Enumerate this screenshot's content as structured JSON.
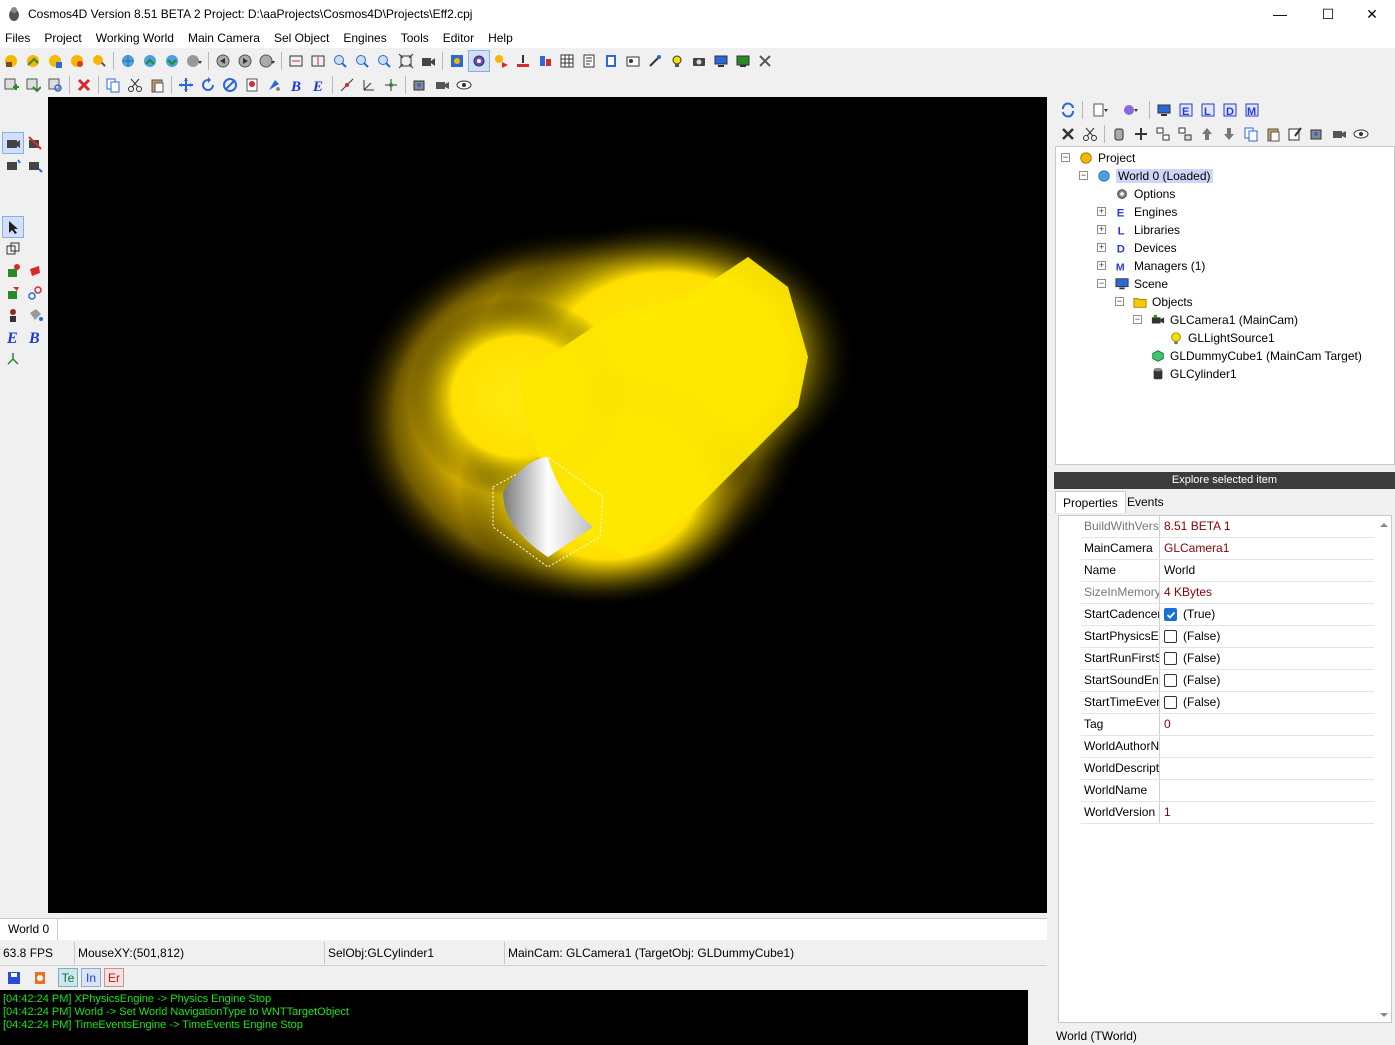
{
  "window": {
    "title": "Cosmos4D Version 8.51 BETA 2   Project: D:\\aaProjects\\Cosmos4D\\Projects\\Eff2.cpj",
    "minimize": "—",
    "maximize": "☐",
    "close": "✕"
  },
  "menu": [
    "Files",
    "Project",
    "Working World",
    "Main Camera",
    "Sel Object",
    "Engines",
    "Tools",
    "Editor",
    "Help"
  ],
  "tree": {
    "project": "Project",
    "world": "World 0  (Loaded)",
    "options": "Options",
    "engines": "Engines",
    "libraries": "Libraries",
    "devices": "Devices",
    "managers": "Managers (1)",
    "scene": "Scene",
    "objects": "Objects",
    "camera": "GLCamera1  (MainCam)",
    "light": "GLLightSource1",
    "dummy": "GLDummyCube1  (MainCam Target)",
    "cylinder": "GLCylinder1"
  },
  "explore_label": "Explore selected item",
  "tabs": {
    "properties": "Properties",
    "events": "Events"
  },
  "props": [
    {
      "name": "BuildWithVers",
      "value": "8.51 BETA 1",
      "grey": true
    },
    {
      "name": "MainCamera",
      "value": "GLCamera1"
    },
    {
      "name": "Name",
      "value": "World",
      "black": true
    },
    {
      "name": "SizeInMemory",
      "value": "4 KBytes",
      "grey": true
    },
    {
      "name": "StartCadencer",
      "value": "(True)",
      "check": true,
      "checked": true
    },
    {
      "name": "StartPhysicsEngine",
      "value": "(False)",
      "check": true
    },
    {
      "name": "StartRunFirstScript",
      "value": "(False)",
      "check": true
    },
    {
      "name": "StartSoundEngine",
      "value": "(False)",
      "check": true
    },
    {
      "name": "StartTimeEvents",
      "value": "(False)",
      "check": true
    },
    {
      "name": "Tag",
      "value": "0"
    },
    {
      "name": "WorldAuthorName",
      "value": ""
    },
    {
      "name": "WorldDescription",
      "value": ""
    },
    {
      "name": "WorldName",
      "value": ""
    },
    {
      "name": "WorldVersion",
      "value": "1"
    }
  ],
  "world_tab": "World 0",
  "status": {
    "fps": "63.8 FPS",
    "mouse": "MouseXY:(501,812)",
    "selobj": "SelObj:GLCylinder1",
    "maincam": "MainCam: GLCamera1 (TargetObj: GLDummyCube1)"
  },
  "log_tabs": [
    "Te",
    "In",
    "Er"
  ],
  "log": [
    "[04:42:24 PM]  XPhysicsEngine -> Physics Engine Stop",
    "[04:42:24 PM]  World -> Set World NavigationType to WNTTargetObject",
    "[04:42:24 PM]  TimeEventsEngine -> TimeEvents Engine Stop"
  ],
  "right_status": "World (TWorld)",
  "colors": {
    "accent": "#1a6fd8",
    "prop_value": "#8b0000",
    "log_text": "#19e619",
    "glow": "#ffe600"
  }
}
